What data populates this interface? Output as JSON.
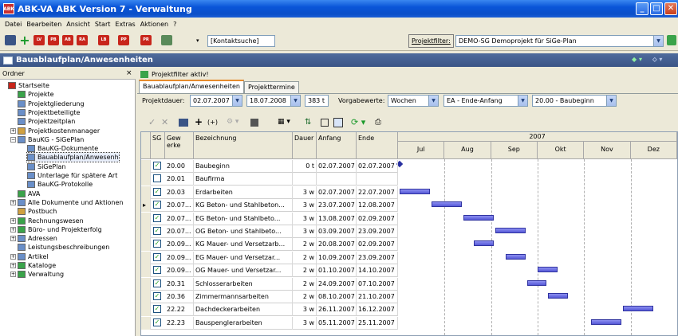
{
  "window": {
    "title": "ABK-VA   ABK Version 7 - Verwaltung",
    "app_icon_text": "ABK",
    "minimize": "_",
    "maximize": "□",
    "close": "✕"
  },
  "menu": [
    "Datei",
    "Bearbeiten",
    "Ansicht",
    "Start",
    "Extras",
    "Aktionen",
    "?"
  ],
  "toolbar": {
    "kontaktsuche": "[Kontaktsuche]",
    "red_icons": [
      "LV",
      "PB",
      "AB",
      "RA",
      "LB",
      "PP",
      "PR"
    ],
    "projektfilter_label": "Projektfilter:",
    "projektfilter_value": "DEMO-SG   Demoprojekt für SiGe-Plan"
  },
  "section": {
    "title": "Bauablaufplan/Anwesenheiten"
  },
  "tree": {
    "header": "Ordner",
    "close": "×",
    "items": [
      {
        "label": "Startseite",
        "level": 0,
        "icon": "#c8251b",
        "exp": ""
      },
      {
        "label": "Projekte",
        "level": 1,
        "icon": "#3aa34a",
        "exp": ""
      },
      {
        "label": "Projektgliederung",
        "level": 1,
        "icon": "#6a8fc8",
        "exp": ""
      },
      {
        "label": "Projektbeteiligte",
        "level": 1,
        "icon": "#6a8fc8",
        "exp": ""
      },
      {
        "label": "Projektzeitplan",
        "level": 1,
        "icon": "#6a8fc8",
        "exp": ""
      },
      {
        "label": "Projektkostenmanager",
        "level": 1,
        "icon": "#d0a040",
        "exp": "+"
      },
      {
        "label": "BauKG - SiGePlan",
        "level": 1,
        "icon": "#6a8fc8",
        "exp": "−"
      },
      {
        "label": "BauKG-Dokumente",
        "level": 2,
        "icon": "#6a8fc8",
        "exp": ""
      },
      {
        "label": "Bauablaufplan/Anwesenh",
        "level": 2,
        "icon": "#6a8fc8",
        "exp": "",
        "selected": true
      },
      {
        "label": "SiGePlan",
        "level": 2,
        "icon": "#6a8fc8",
        "exp": ""
      },
      {
        "label": "Unterlage für spätere Art",
        "level": 2,
        "icon": "#6a8fc8",
        "exp": ""
      },
      {
        "label": "BauKG-Protokolle",
        "level": 2,
        "icon": "#6a8fc8",
        "exp": ""
      },
      {
        "label": "AVA",
        "level": 1,
        "icon": "#3aa34a",
        "exp": ""
      },
      {
        "label": "Alle Dokumente und Aktionen",
        "level": 1,
        "icon": "#6a8fc8",
        "exp": "+"
      },
      {
        "label": "Postbuch",
        "level": 1,
        "icon": "#d0a040",
        "exp": ""
      },
      {
        "label": "Rechnungswesen",
        "level": 1,
        "icon": "#3aa34a",
        "exp": "+"
      },
      {
        "label": "Büro- und Projekterfolg",
        "level": 1,
        "icon": "#3aa34a",
        "exp": "+"
      },
      {
        "label": "Adressen",
        "level": 1,
        "icon": "#6a8fc8",
        "exp": "+"
      },
      {
        "label": "Leistungsbeschreibungen",
        "level": 1,
        "icon": "#6a8fc8",
        "exp": ""
      },
      {
        "label": "Artikel",
        "level": 1,
        "icon": "#6a8fc8",
        "exp": "+"
      },
      {
        "label": "Kataloge",
        "level": 1,
        "icon": "#3aa34a",
        "exp": "+"
      },
      {
        "label": "Verwaltung",
        "level": 1,
        "icon": "#3aa34a",
        "exp": "+"
      }
    ]
  },
  "content": {
    "filter_notice": "Projektfilter aktiv!",
    "tabs": [
      "Bauablaufplan/Anwesenheiten",
      "Projekttermine"
    ],
    "options": {
      "projektdauer_label": "Projektdauer:",
      "start_date": "02.07.2007",
      "end_date": "18.07.2008",
      "duration": "383 t",
      "vorgabewerte_label": "Vorgabewerte:",
      "unit": "Wochen",
      "link_type": "EA - Ende-Anfang",
      "phase": "20.00 - Baubeginn"
    }
  },
  "grid": {
    "headers": {
      "sg": "SG",
      "gewerke": "Gew erke",
      "bezeichnung": "Bezeichnung",
      "dauer": "Dauer",
      "anfang": "Anfang",
      "ende": "Ende"
    },
    "year": "2007",
    "months": [
      "Jul",
      "Aug",
      "Sep",
      "Okt",
      "Nov",
      "Dez"
    ],
    "rows": [
      {
        "gew": "20.00",
        "bez": "Baubeginn",
        "dauer": "0 t",
        "anfang": "02.07.2007",
        "ende": "02.07.2007",
        "checked": true
      },
      {
        "gew": "20.01",
        "bez": "Baufirma",
        "dauer": "",
        "anfang": "",
        "ende": "",
        "checked": false
      },
      {
        "gew": "20.03",
        "bez": "Erdarbeiten",
        "dauer": "3 w",
        "anfang": "02.07.2007",
        "ende": "22.07.2007",
        "checked": true
      },
      {
        "gew": "20.07...",
        "bez": "KG Beton- und Stahlbeton...",
        "dauer": "3 w",
        "anfang": "23.07.2007",
        "ende": "12.08.2007",
        "checked": true,
        "current": true
      },
      {
        "gew": "20.07...",
        "bez": "EG Beton- und Stahlbeto...",
        "dauer": "3 w",
        "anfang": "13.08.2007",
        "ende": "02.09.2007",
        "checked": true
      },
      {
        "gew": "20.07...",
        "bez": "OG Beton- und Stahlbeto...",
        "dauer": "3 w",
        "anfang": "03.09.2007",
        "ende": "23.09.2007",
        "checked": true
      },
      {
        "gew": "20.09...",
        "bez": "KG Mauer- und Versetzarb...",
        "dauer": "2 w",
        "anfang": "20.08.2007",
        "ende": "02.09.2007",
        "checked": true
      },
      {
        "gew": "20.09...",
        "bez": "EG Mauer- und Versetzar...",
        "dauer": "2 w",
        "anfang": "10.09.2007",
        "ende": "23.09.2007",
        "checked": true
      },
      {
        "gew": "20.09...",
        "bez": "OG Mauer- und Versetzar...",
        "dauer": "2 w",
        "anfang": "01.10.2007",
        "ende": "14.10.2007",
        "checked": true
      },
      {
        "gew": "20.31",
        "bez": "Schlosserarbeiten",
        "dauer": "2 w",
        "anfang": "24.09.2007",
        "ende": "07.10.2007",
        "checked": true
      },
      {
        "gew": "20.36",
        "bez": "Zimmermannsarbeiten",
        "dauer": "2 w",
        "anfang": "08.10.2007",
        "ende": "21.10.2007",
        "checked": true
      },
      {
        "gew": "22.22",
        "bez": "Dachdeckerarbeiten",
        "dauer": "3 w",
        "anfang": "26.11.2007",
        "ende": "16.12.2007",
        "checked": true
      },
      {
        "gew": "22.23",
        "bez": "Bauspenglerarbeiten",
        "dauer": "3 w",
        "anfang": "05.11.2007",
        "ende": "25.11.2007",
        "checked": true
      }
    ]
  }
}
